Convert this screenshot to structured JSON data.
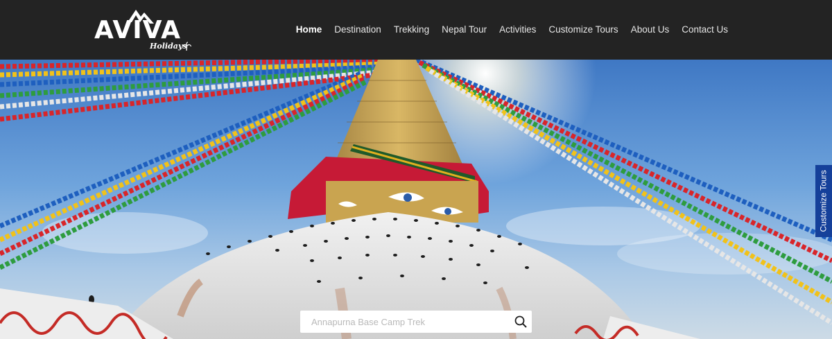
{
  "header": {
    "logo_text": "AVIVA",
    "logo_subtext": "Holidays"
  },
  "nav": {
    "items": [
      {
        "label": "Home",
        "active": true
      },
      {
        "label": "Destination"
      },
      {
        "label": "Trekking"
      },
      {
        "label": "Nepal Tour"
      },
      {
        "label": "Activities"
      },
      {
        "label": "Customize Tours"
      },
      {
        "label": "About Us"
      },
      {
        "label": "Contact Us"
      }
    ]
  },
  "side_tab": {
    "label": "Customize Tours"
  },
  "search": {
    "placeholder": "Annapurna Base Camp Trek"
  },
  "colors": {
    "header_bg": "#232323",
    "side_tab_bg": "#15409a",
    "sky": "#3f78c4"
  },
  "icons": {
    "search": "search-icon",
    "logo_mountain": "mountain-icon",
    "logo_palm": "palm-tree-icon"
  }
}
